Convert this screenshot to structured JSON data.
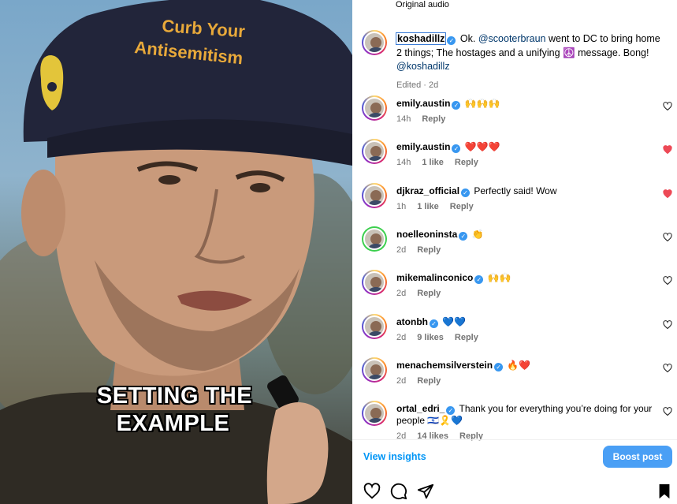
{
  "media": {
    "caption_line1": "SETTING THE",
    "caption_line2": "EXAMPLE",
    "hat_text_line1": "Curb Your",
    "hat_text_line2": "Antisemitism"
  },
  "panel": {
    "audio_label": "Original audio",
    "post": {
      "username": "koshadillz",
      "text_before_mention": "Ok.",
      "mention": "@scooterbraun",
      "text_after_mention": "went to DC to bring home 2 things; The hostages and a unifying",
      "emoji_mid": "☮️",
      "text_end": "message. Bong!",
      "mention2": "@koshadillz",
      "meta": "Edited · 2d"
    },
    "comments": [
      {
        "username": "emily.austin",
        "text": "🙌🙌🙌",
        "time": "14h",
        "likes": "",
        "reply": "Reply",
        "liked": false
      },
      {
        "username": "emily.austin",
        "text": "❤️❤️❤️",
        "time": "14h",
        "likes": "1 like",
        "reply": "Reply",
        "liked": true
      },
      {
        "username": "djkraz_official",
        "text": "Perfectly said! Wow",
        "time": "1h",
        "likes": "1 like",
        "reply": "Reply",
        "liked": true
      },
      {
        "username": "noelleoninsta",
        "text": "👏",
        "time": "2d",
        "likes": "",
        "reply": "Reply",
        "liked": false
      },
      {
        "username": "mikemalinconico",
        "text": "🙌🙌",
        "time": "2d",
        "likes": "",
        "reply": "Reply",
        "liked": false
      },
      {
        "username": "atonbh",
        "text": "💙💙",
        "time": "2d",
        "likes": "9 likes",
        "reply": "Reply",
        "liked": false
      },
      {
        "username": "menachemsilverstein",
        "text": "🔥❤️",
        "time": "2d",
        "likes": "",
        "reply": "Reply",
        "liked": false
      },
      {
        "username": "ortal_edri_",
        "text": "Thank you for everything you’re doing for your people 🇮🇱🎗️💙",
        "time": "2d",
        "likes": "14 likes",
        "reply": "Reply",
        "liked": false
      }
    ],
    "view_insights": "View insights",
    "boost_post": "Boost post"
  },
  "colors": {
    "accent": "#0095f6",
    "boost_bg": "#4a9ff5",
    "heart_red": "#ed4956",
    "verified": "#3897f0"
  },
  "icons": [
    "heart-icon",
    "comment-icon",
    "share-icon",
    "bookmark-icon",
    "verified-icon"
  ]
}
